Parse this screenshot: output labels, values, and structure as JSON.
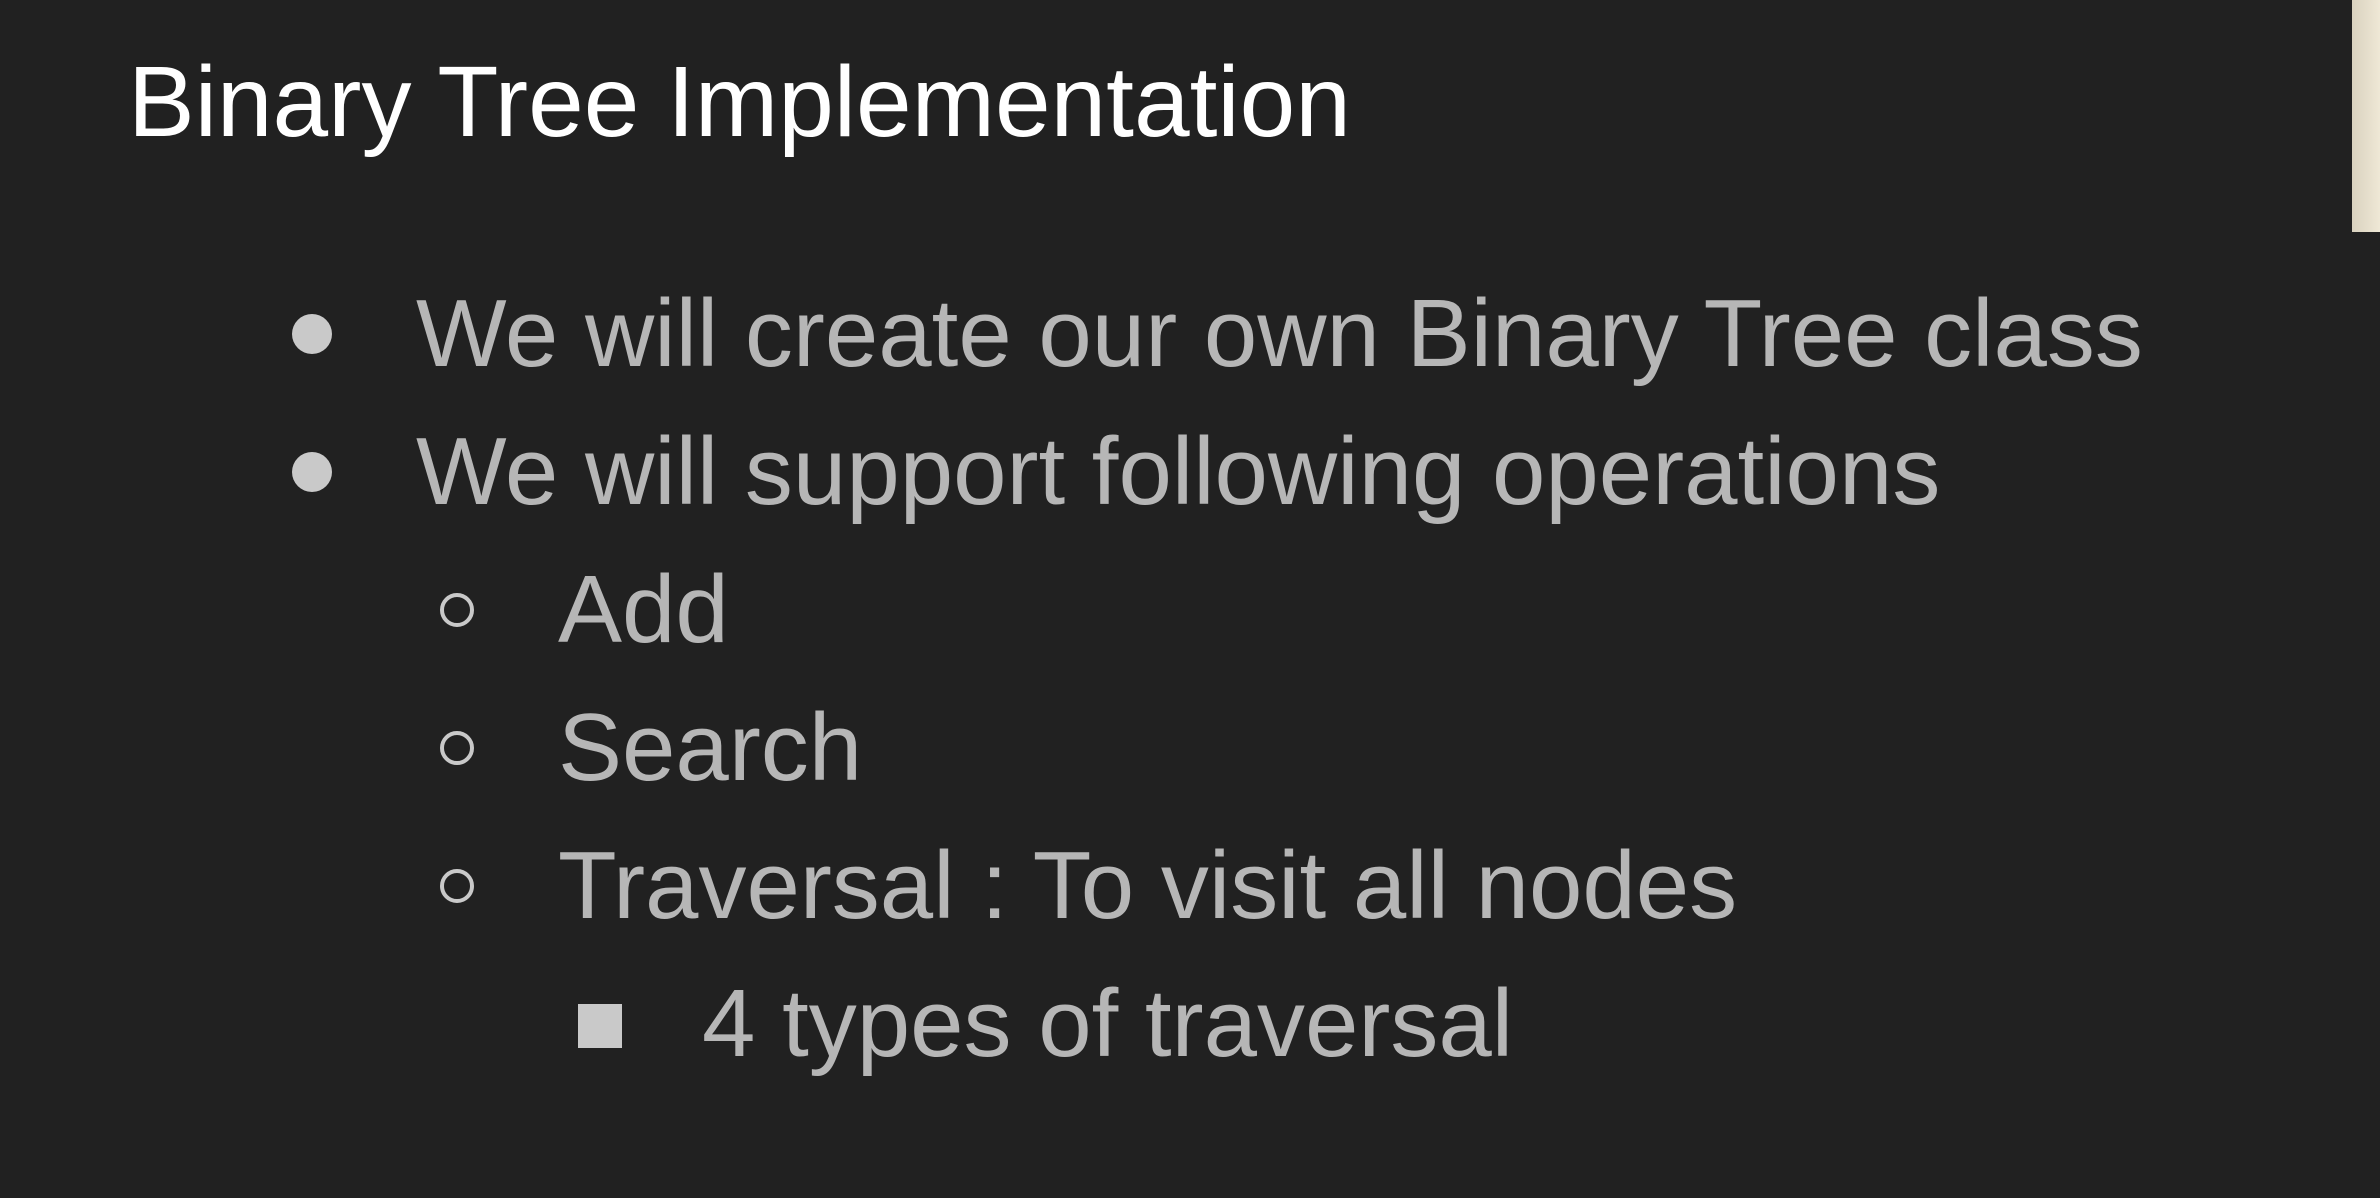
{
  "slide": {
    "title": "Binary Tree Implementation",
    "bullets": [
      {
        "level": 1,
        "marker": "disc",
        "text": "We will create our own Binary Tree class"
      },
      {
        "level": 1,
        "marker": "disc",
        "text": "We will support following operations"
      },
      {
        "level": 2,
        "marker": "hollow-circle",
        "text": "Add"
      },
      {
        "level": 2,
        "marker": "hollow-circle",
        "text": "Search"
      },
      {
        "level": 2,
        "marker": "hollow-circle",
        "text": "Traversal : To visit all nodes"
      },
      {
        "level": 3,
        "marker": "square",
        "text": "4 types of traversal"
      }
    ]
  },
  "colors": {
    "background": "#212121",
    "title": "#ffffff",
    "body_text": "#b6b6b6",
    "bullet_marker": "#c9c9c9",
    "edge_strip": "#e6dfcc"
  }
}
